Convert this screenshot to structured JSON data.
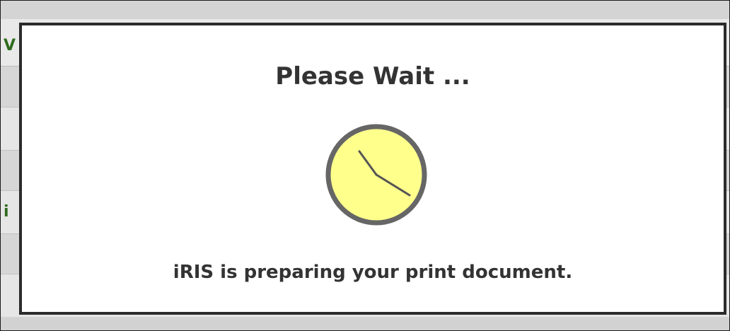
{
  "dialog": {
    "title": "Please Wait ...",
    "message": "iRIS is preparing your print document.",
    "icon": "clock-icon"
  },
  "background": {
    "peek_fragment_1": "V",
    "peek_fragment_2": "i"
  },
  "colors": {
    "dialog_border": "#2b2b2b",
    "clock_face": "#ffff8c",
    "clock_rim": "#666666",
    "text": "#333333",
    "background_green_text": "#2f6b1e"
  }
}
